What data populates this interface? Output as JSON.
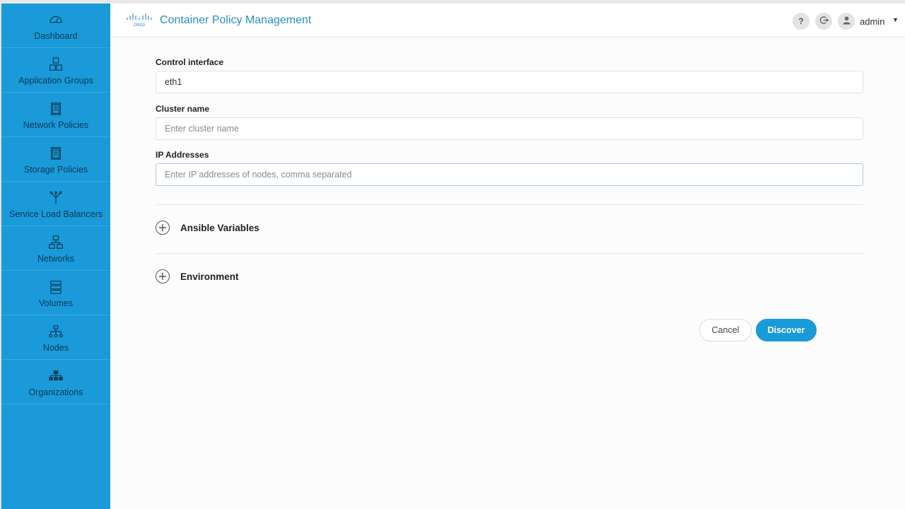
{
  "header": {
    "logo_text": "cisco",
    "title": "Container Policy Management",
    "help_symbol": "?",
    "user_name": "admin",
    "caret": "▼"
  },
  "sidebar": {
    "items": [
      {
        "label": "Dashboard",
        "icon": "gauge-icon"
      },
      {
        "label": "Application Groups",
        "icon": "app-groups-icon"
      },
      {
        "label": "Network Policies",
        "icon": "policy-document-icon"
      },
      {
        "label": "Storage Policies",
        "icon": "storage-document-icon"
      },
      {
        "label": "Service Load Balancers",
        "icon": "load-balancer-icon"
      },
      {
        "label": "Networks",
        "icon": "network-icon"
      },
      {
        "label": "Volumes",
        "icon": "volumes-icon"
      },
      {
        "label": "Nodes",
        "icon": "nodes-icon"
      },
      {
        "label": "Organizations",
        "icon": "organizations-icon"
      }
    ]
  },
  "form": {
    "control_interface": {
      "label": "Control interface",
      "value": "eth1"
    },
    "cluster_name": {
      "label": "Cluster name",
      "placeholder": "Enter cluster name"
    },
    "ip_addresses": {
      "label": "IP Addresses",
      "placeholder": "Enter IP addresses of nodes, comma separated"
    },
    "sections": [
      {
        "label": "Ansible Variables"
      },
      {
        "label": "Environment"
      }
    ],
    "cancel_label": "Cancel",
    "discover_label": "Discover"
  },
  "colors": {
    "sidebar": "#1a9ad8",
    "accent": "#2a8fc7",
    "primary_button": "#1a9ad8"
  }
}
